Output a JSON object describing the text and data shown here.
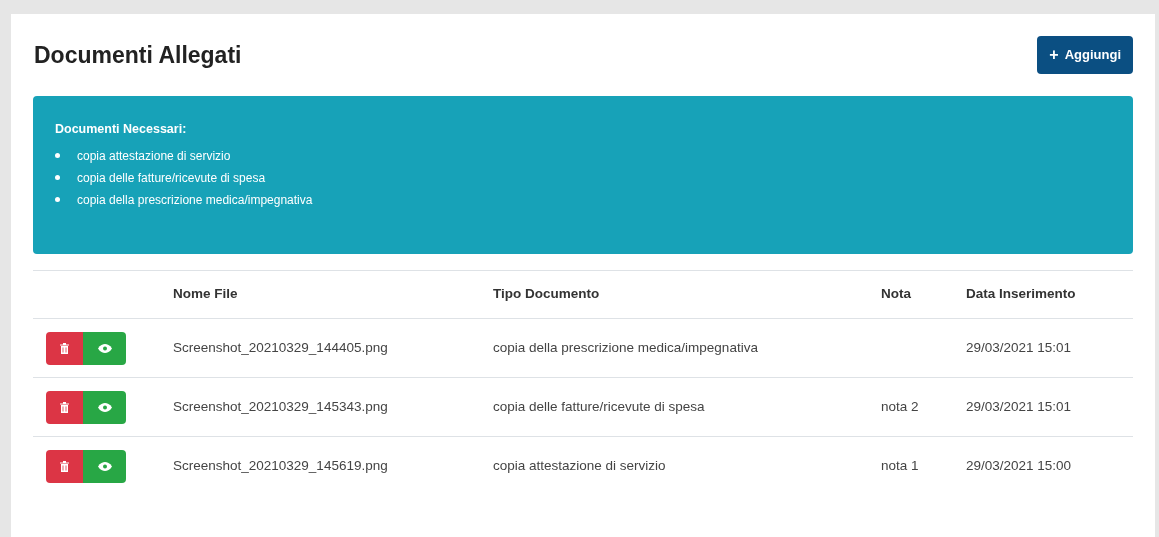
{
  "title": "Documenti Allegati",
  "add_button": {
    "icon": "+",
    "label": "Aggiungi"
  },
  "alert": {
    "heading": "Documenti Necessari:",
    "items": [
      "copia attestazione di servizio",
      "copia delle fatture/ricevute di spesa",
      "copia della prescrizione medica/impegnativa"
    ]
  },
  "table": {
    "columns": [
      "Nome File",
      "Tipo Documento",
      "Nota",
      "Data Inserimento"
    ],
    "rows": [
      {
        "file": "Screenshot_20210329_144405.png",
        "type": "copia della prescrizione medica/impegnativa",
        "date": "29/03/2021 15:01"
      },
      {
        "file": "Screenshot_20210329_145343.png",
        "type": "copia delle fatture/ricevute di spesa",
        "note": "nota 2",
        "date": "29/03/2021 15:01"
      },
      {
        "file": "Screenshot_20210329_145619.png",
        "type": "copia attestazione di servizio",
        "note": "nota 1",
        "date": "29/03/2021 15:00"
      }
    ]
  }
}
